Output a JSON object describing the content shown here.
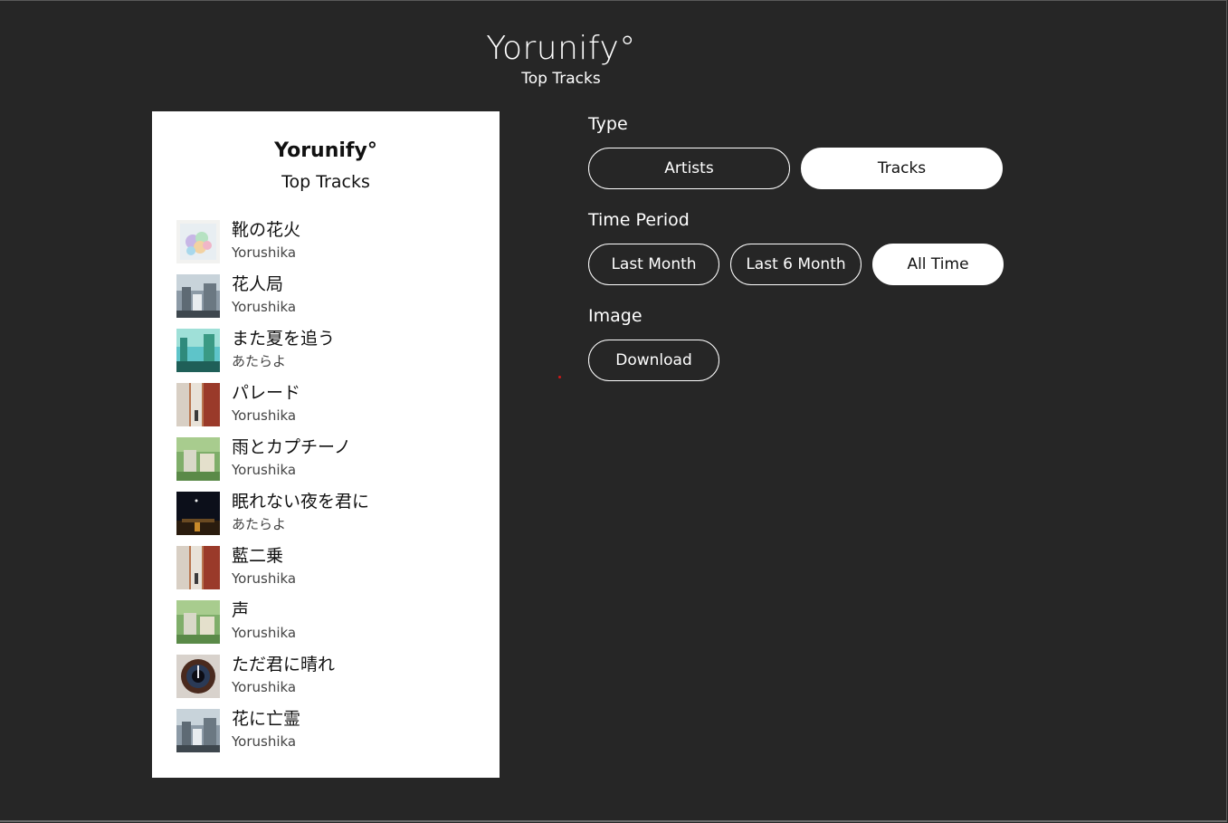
{
  "header": {
    "title": "Yorunify°",
    "subtitle": "Top Tracks"
  },
  "card": {
    "title": "Yorunify°",
    "subtitle": "Top Tracks",
    "tracks": [
      {
        "name": "靴の花火",
        "artist": "Yorushika",
        "cover": "album-cover"
      },
      {
        "name": "花人局",
        "artist": "Yorushika",
        "cover": "album-cover"
      },
      {
        "name": "また夏を追う",
        "artist": "あたらよ",
        "cover": "album-cover"
      },
      {
        "name": "パレード",
        "artist": "Yorushika",
        "cover": "album-cover"
      },
      {
        "name": "雨とカプチーノ",
        "artist": "Yorushika",
        "cover": "album-cover"
      },
      {
        "name": "眠れない夜を君に",
        "artist": "あたらよ",
        "cover": "album-cover"
      },
      {
        "name": "藍二乗",
        "artist": "Yorushika",
        "cover": "album-cover"
      },
      {
        "name": "声",
        "artist": "Yorushika",
        "cover": "album-cover"
      },
      {
        "name": "ただ君に晴れ",
        "artist": "Yorushika",
        "cover": "album-cover"
      },
      {
        "name": "花に亡霊",
        "artist": "Yorushika",
        "cover": "album-cover"
      }
    ]
  },
  "controls": {
    "type": {
      "label": "Type",
      "options": [
        "Artists",
        "Tracks"
      ],
      "selected": "Tracks"
    },
    "period": {
      "label": "Time Period",
      "options": [
        "Last Month",
        "Last 6 Month",
        "All Time"
      ],
      "selected": "All Time"
    },
    "image": {
      "label": "Image",
      "download_label": "Download"
    }
  },
  "colors": {
    "background": "#262626",
    "card": "#ffffff",
    "accent_dot": "#d01818"
  }
}
